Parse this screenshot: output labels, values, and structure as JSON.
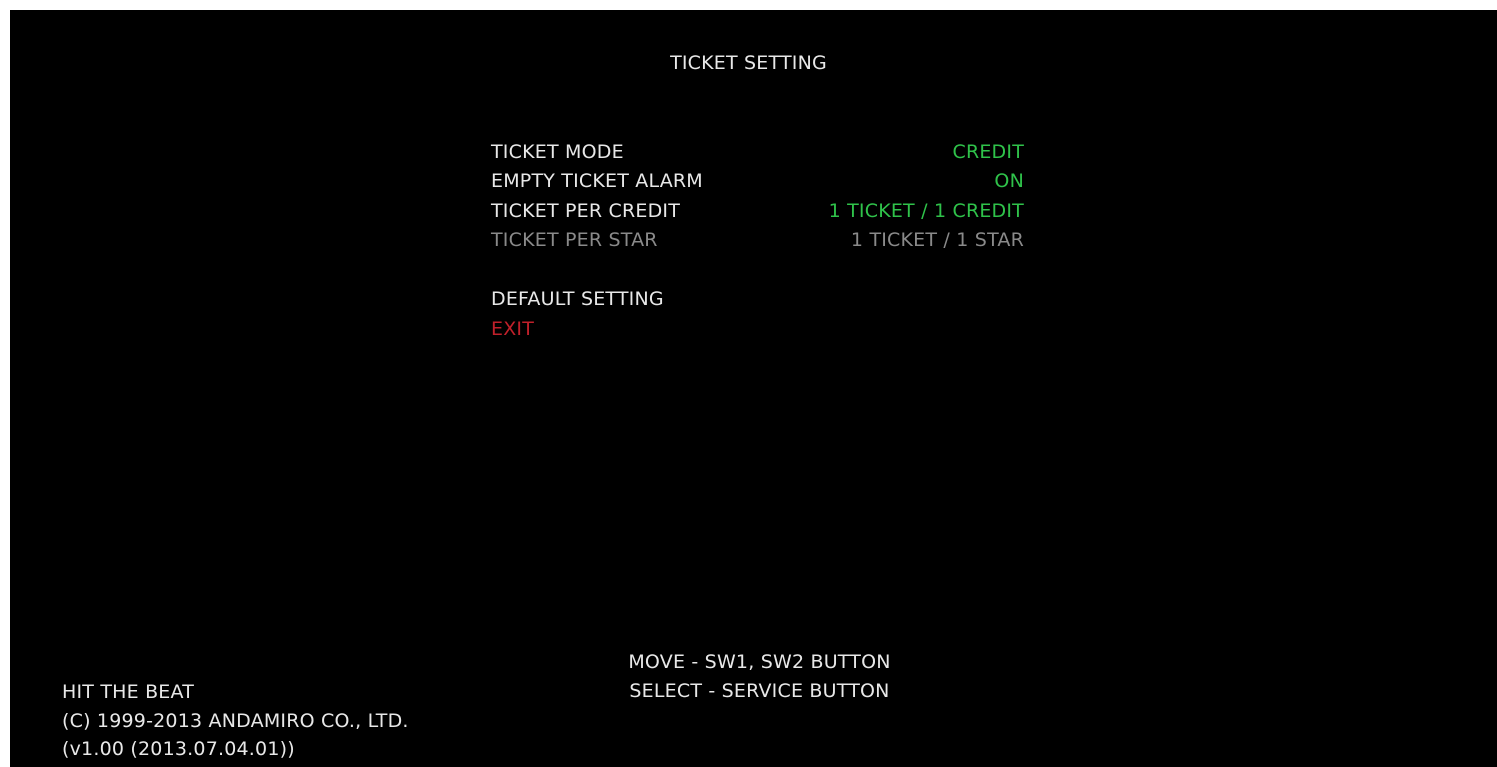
{
  "title": "TICKET SETTING",
  "menu": {
    "items": [
      {
        "label": "TICKET MODE",
        "value": "CREDIT"
      },
      {
        "label": "EMPTY TICKET ALARM",
        "value": "ON"
      },
      {
        "label": "TICKET PER CREDIT",
        "value": "1 TICKET / 1 CREDIT"
      },
      {
        "label": "TICKET PER STAR",
        "value": "1 TICKET / 1 STAR"
      }
    ],
    "default_setting": "DEFAULT SETTING",
    "exit": "EXIT"
  },
  "controls": {
    "move": "MOVE - SW1, SW2 BUTTON",
    "select": "SELECT - SERVICE BUTTON"
  },
  "info": {
    "game": "HIT THE BEAT",
    "copyright": "(C) 1999-2013 ANDAMIRO CO., LTD.",
    "version": "(v1.00 (2013.07.04.01))"
  },
  "colors": {
    "background": "#000000",
    "text": "#e8e8e8",
    "value": "#2fc24a",
    "disabled": "#8a8a8a",
    "exit": "#c0202a"
  }
}
